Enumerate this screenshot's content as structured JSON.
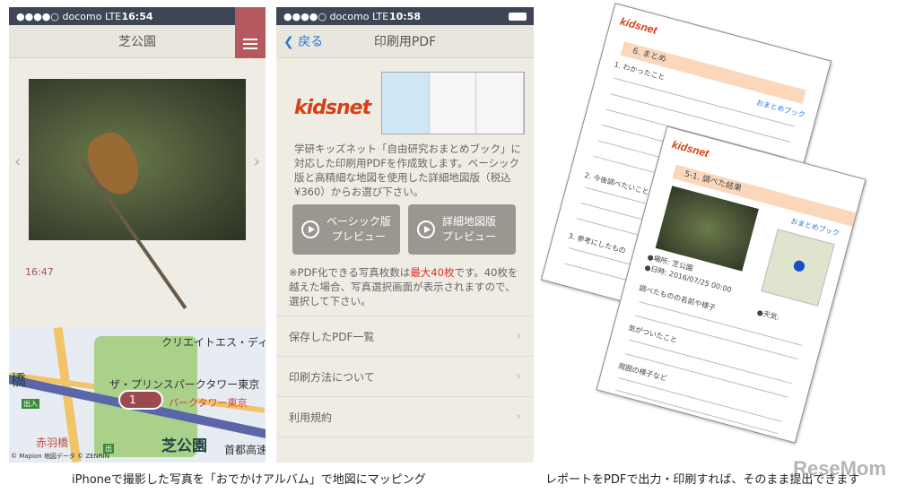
{
  "left_phone": {
    "carrier": "●●●●○ docomo",
    "network": "LTE",
    "time": "16:54",
    "title": "芝公園",
    "photo_time": "16:47",
    "map": {
      "labels": [
        "クリエイトエス・ディ",
        "ザ・プリンスパークタワー東京",
        "パークタワー東京",
        "芝公園",
        "首都高速",
        "赤羽橋",
        "橋",
        "出入",
        "出"
      ],
      "pin_count": "1",
      "copyright": "© Mapion 地図データ © ZENRIN"
    }
  },
  "right_phone": {
    "carrier": "●●●●○ docomo",
    "network": "LTE",
    "time": "10:58",
    "back_label": "戻る",
    "title": "印刷用PDF",
    "logo": "kidsnet",
    "description": "学研キッズネット「自由研究おまとめブック」に対応した印刷用PDFを作成致します。ベーシック版と高精細な地図を使用した詳細地図版（税込¥360）からお選び下さい。",
    "buttons": [
      {
        "line1": "ベーシック版",
        "line2": "プレビュー"
      },
      {
        "line1": "詳細地図版",
        "line2": "プレビュー"
      }
    ],
    "note_prefix": "※PDF化できる写真枚数は",
    "note_highlight": "最大40枚",
    "note_suffix": "です。40枚を越えた場合、写真選択画面が表示されますので、選択して下さい。",
    "menu": [
      "保存したPDF一覧",
      "印刷方法について",
      "利用規約"
    ]
  },
  "papers": {
    "back": {
      "logo": "kidsnet",
      "section": "6. まとめ",
      "badge": "おまとめブック",
      "items": [
        "1. わかったこと",
        "2. 今後調べたいこと",
        "3. 参考にしたもの"
      ]
    },
    "front": {
      "logo": "kidsnet",
      "section": "5-1. 調べた結果",
      "badge": "おまとめブック",
      "place": "●場所: 芝公園",
      "date": "●日時: 2016/07/25 00:00",
      "weather": "●天気:",
      "items": [
        "調べたものの名前や様子",
        "気がついたこと",
        "周囲の様子など"
      ]
    }
  },
  "captions": {
    "left": "iPhoneで撮影した写真を「おでかけアルバム」で地図にマッピング",
    "right": "レポートをPDFで出力・印刷すれば、そのまま提出できます"
  },
  "watermark": "ReseMom"
}
